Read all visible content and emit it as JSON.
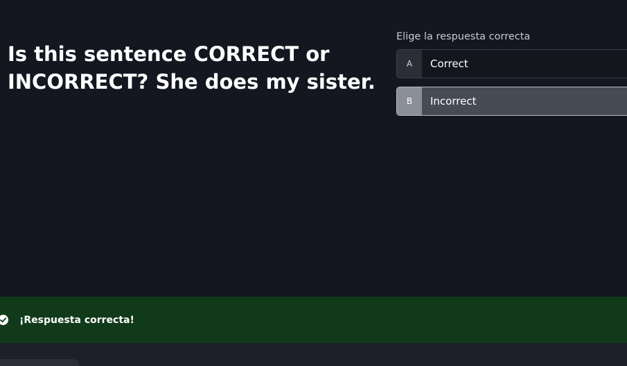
{
  "question": {
    "text": "Is this sentence CORRECT or INCORRECT? She does my sister."
  },
  "answers": {
    "prompt": "Elige la respuesta correcta",
    "options": [
      {
        "letter": "A",
        "label": "Correct",
        "selected": false
      },
      {
        "letter": "B",
        "label": "Incorrect",
        "selected": true
      }
    ]
  },
  "feedback": {
    "icon": "check-circle-icon",
    "message": "¡Respuesta correcta!",
    "color": "#113a1a"
  },
  "colors": {
    "background": "#141720",
    "selected_option": "#474b55"
  }
}
